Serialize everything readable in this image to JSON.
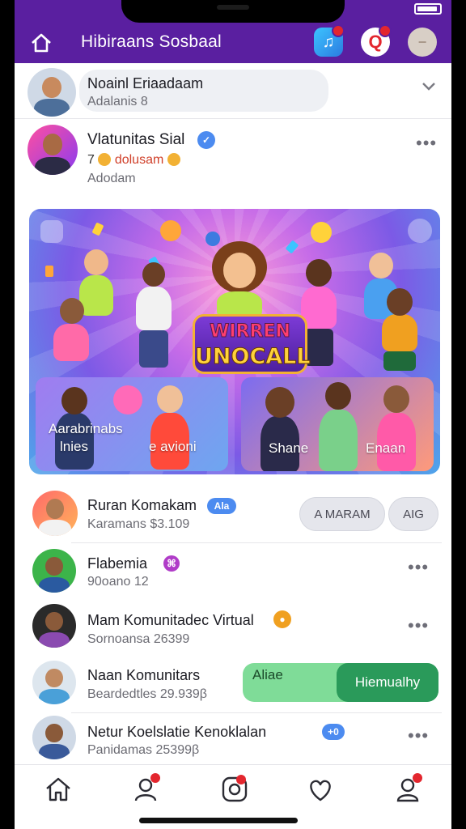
{
  "header": {
    "title": "Hibiraans Sosbaal",
    "icons": [
      "home-icon",
      "music-app-icon",
      "q-app-icon",
      "profile-avatar"
    ],
    "accent_color": "#5a1fa0"
  },
  "search_row": {
    "name": "Noainl Eriaadaam",
    "sub": "Adalanis 8"
  },
  "featured_user": {
    "name": "Vlatunitas Sial",
    "stats": "7 ☺ dolusam ☺",
    "stats_prefix": "7",
    "stats_text": "dolusam",
    "sub": "Adodam"
  },
  "banner": {
    "logo_line1": "WIRREN",
    "logo_line2": "UNOCALL",
    "tile_left_line1": "Aarabrinabs",
    "tile_left_line2": "lnies",
    "tile_left_line3": "e avioni",
    "tile_right_line1": "Shane",
    "tile_right_line2": "Enaan"
  },
  "users": [
    {
      "name": "Ruran Komakam",
      "sub": "Karamans $3.109",
      "chip": "Ala",
      "btn1": "A MARAM",
      "btn2": "AIG"
    },
    {
      "name": "Flabemia",
      "sub": "90oano 12",
      "chip": "⌘"
    },
    {
      "name": "Mam Komunitadec Virtual",
      "sub": "Sornoansa 26399",
      "chip": "●"
    },
    {
      "name": "Naan Komunitars",
      "sub": "Beardedtles 29.939β",
      "chip": "Aliae",
      "btn": "Hiemualhy"
    },
    {
      "name": "Netur Koelslatie Kenoklalan",
      "sub": "Panidamas 25399β",
      "chip": "+0"
    }
  ],
  "bottom_nav": [
    "home-tab",
    "people-tab",
    "camera-tab",
    "likes-tab",
    "profile-tab"
  ]
}
